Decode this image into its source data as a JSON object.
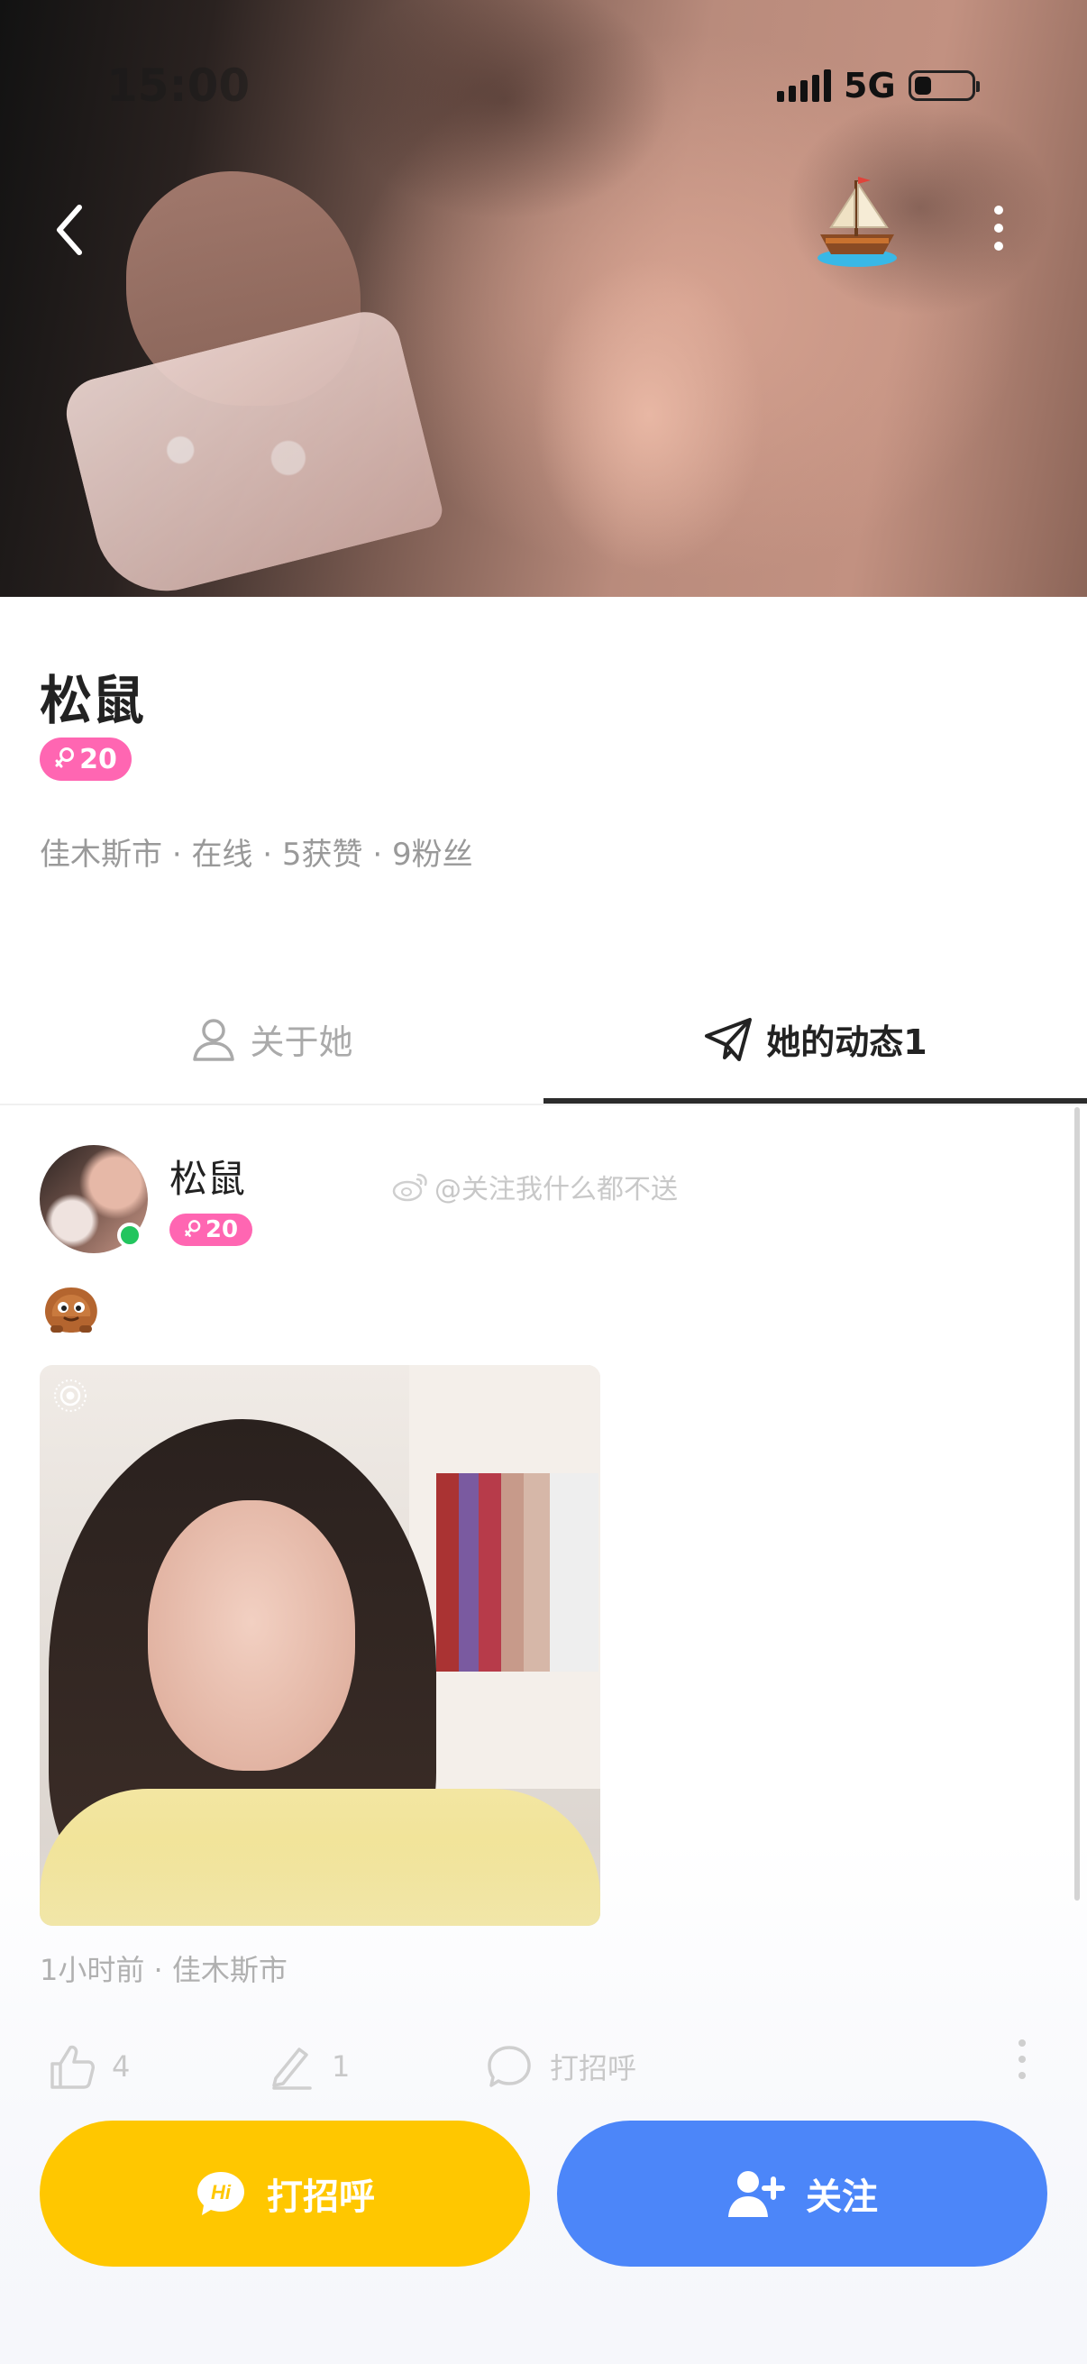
{
  "status_bar": {
    "time": "15:00",
    "network": "5G",
    "battery_level": 0.3
  },
  "profile": {
    "name": "松鼠",
    "age": "20",
    "location": "佳木斯市",
    "online": "在线",
    "likes": "5获赞",
    "fans": "9粉丝"
  },
  "tabs": [
    {
      "label": "关于她",
      "icon": "user-icon",
      "active": false
    },
    {
      "label": "她的动态",
      "count": "1",
      "icon": "send-icon",
      "active": true
    }
  ],
  "post": {
    "author": "松鼠",
    "age": "20",
    "watermark": "@关注我什么都不送",
    "time": "1小时前",
    "location": "佳木斯市",
    "like_count": "4",
    "comment_count": "1",
    "greet_label": "打招呼"
  },
  "actions": {
    "greet": "打招呼",
    "follow": "关注"
  },
  "colors": {
    "accent_yellow": "#ffc700",
    "accent_blue": "#4c86f9",
    "badge_pink": "#ff66b2",
    "online_green": "#22c55e"
  },
  "icons": [
    "back-icon",
    "boat-icon",
    "more-icon",
    "user-icon",
    "send-icon",
    "weibo-icon",
    "sticker-icon",
    "live-photo-icon",
    "thumbs-up-icon",
    "pen-icon",
    "chat-bubble-icon",
    "hi-icon",
    "add-user-icon",
    "female-icon"
  ]
}
